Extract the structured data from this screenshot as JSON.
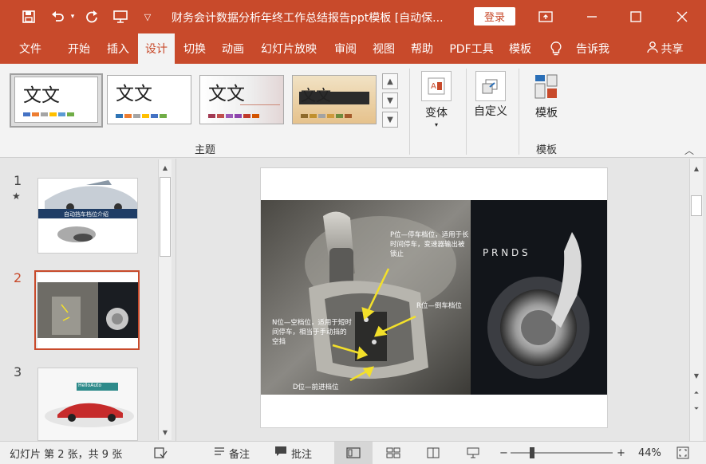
{
  "titlebar": {
    "doc_title": "财务会计数据分析年终工作总结报告ppt模板 [自动保...",
    "login_label": "登录",
    "save_icon": "save-icon",
    "undo_icon": "undo-icon",
    "redo_icon": "repeat-icon",
    "present_icon": "slideshow-icon",
    "customize_icon": "chevron-down-icon"
  },
  "tabs": [
    {
      "label": "文件"
    },
    {
      "label": "开始"
    },
    {
      "label": "插入"
    },
    {
      "label": "设计"
    },
    {
      "label": "切换"
    },
    {
      "label": "动画"
    },
    {
      "label": "幻灯片放映"
    },
    {
      "label": "审阅"
    },
    {
      "label": "视图"
    },
    {
      "label": "帮助"
    },
    {
      "label": "PDF工具"
    },
    {
      "label": "模板"
    },
    {
      "label": "告诉我"
    }
  ],
  "share_label": "共享",
  "ribbon": {
    "theme_group_label": "主题",
    "theme_text": "文文",
    "variant_label": "变体",
    "custom_label": "自定义",
    "template_button_label": "模板",
    "template_group_label": "模板"
  },
  "thumbnails": {
    "slides": [
      {
        "number": "1",
        "star": "★",
        "caption": "自动挡车档位介绍"
      },
      {
        "number": "2",
        "star": ""
      },
      {
        "number": "3",
        "star": "",
        "caption": "HelloAuto"
      }
    ]
  },
  "slide": {
    "label_p": "P位—停车档位，适用于长时间停车，变速器输出被锁止",
    "label_r": "R位—倒车档位",
    "label_n": "N位—空档位，适用于短时间停车，相当于手动挡的空挡",
    "label_d": "D位—前进档位",
    "gear_letters": "P R N D S"
  },
  "status": {
    "slide_info": "幻灯片 第 2 张，共 9 张",
    "notes_label": "备注",
    "comments_label": "批注",
    "zoom_minus": "−",
    "zoom_plus": "+",
    "zoom_level": "44%",
    "zoom_fraction": 0.44
  },
  "colors": {
    "accent": "#c84a2b",
    "active_thumb_border": "#c84a2b",
    "arrow": "#f3e02a"
  }
}
